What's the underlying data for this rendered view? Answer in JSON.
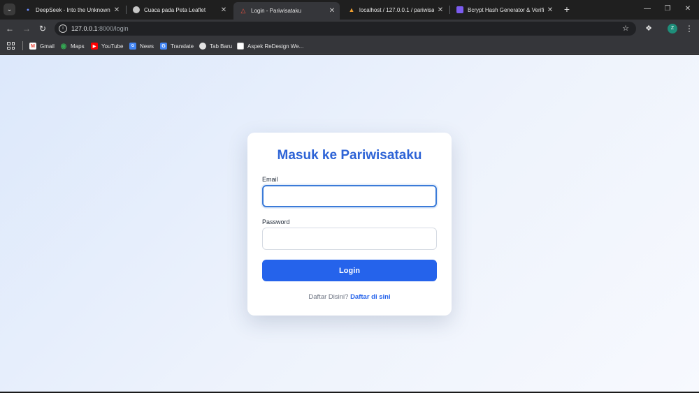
{
  "browser": {
    "tabs": [
      {
        "title": "DeepSeek - Into the Unknown",
        "icon": "deepseek-whale-icon",
        "active": false
      },
      {
        "title": "Cuaca pada Peta Leaflet",
        "icon": "globe-icon",
        "active": false
      },
      {
        "title": "Login - Pariwisataku",
        "icon": "laravel-icon",
        "active": true
      },
      {
        "title": "localhost / 127.0.0.1 / pariwisat",
        "icon": "phpmyadmin-icon",
        "active": false
      },
      {
        "title": "Bcrypt Hash Generator & Verifie",
        "icon": "bcrypt-icon",
        "active": false
      }
    ],
    "new_tab_label": "+",
    "url_host": "127.0.0.1",
    "url_path": ":8000/login",
    "avatar_letter": "Z",
    "bookmarks": [
      {
        "label": "Gmail",
        "icon": "gmail-icon"
      },
      {
        "label": "Maps",
        "icon": "maps-icon"
      },
      {
        "label": "YouTube",
        "icon": "youtube-icon"
      },
      {
        "label": "News",
        "icon": "news-icon"
      },
      {
        "label": "Translate",
        "icon": "translate-icon"
      },
      {
        "label": "Tab Baru",
        "icon": "globe-icon"
      },
      {
        "label": "Aspek ReDesign We...",
        "icon": "doc-icon"
      }
    ]
  },
  "login": {
    "title": "Masuk ke Pariwisataku",
    "email_label": "Email",
    "email_value": "",
    "password_label": "Password",
    "password_value": "",
    "submit_label": "Login",
    "register_prompt": "Daftar Disini?",
    "register_link": "Daftar di sini"
  },
  "colors": {
    "accent": "#2563eb",
    "title": "#2d63d6",
    "page_bg_start": "#dce8fb",
    "page_bg_end": "#f7f9fe"
  }
}
